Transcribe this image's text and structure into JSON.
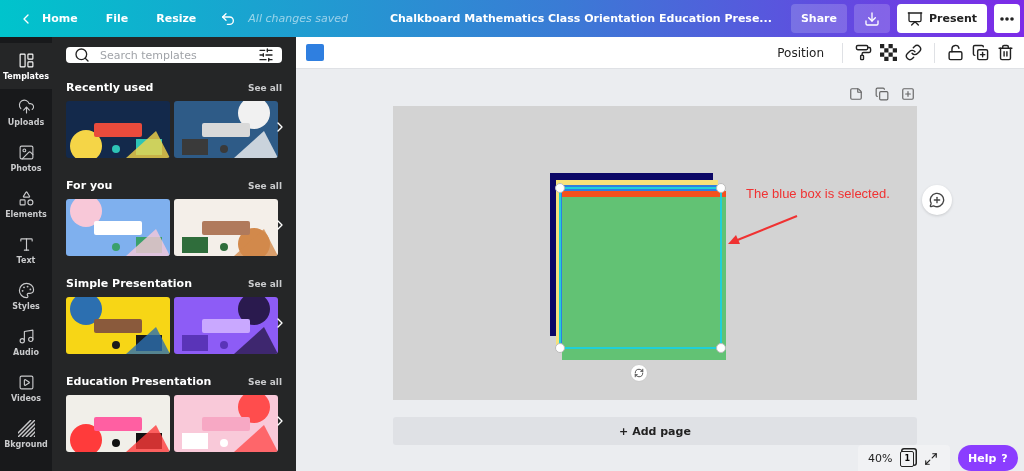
{
  "top_bar": {
    "back_label": "Home",
    "menu": [
      "File",
      "Resize"
    ],
    "status": "All changes saved",
    "title": "Chalkboard Mathematics Class Orientation Education Prese...",
    "share": "Share",
    "present": "Present"
  },
  "rail": [
    {
      "kind": "templates",
      "label": "Templates",
      "selected": true
    },
    {
      "kind": "uploads",
      "label": "Uploads",
      "selected": false
    },
    {
      "kind": "photos",
      "label": "Photos",
      "selected": false
    },
    {
      "kind": "elements",
      "label": "Elements",
      "selected": false
    },
    {
      "kind": "text",
      "label": "Text",
      "selected": false
    },
    {
      "kind": "styles",
      "label": "Styles",
      "selected": false
    },
    {
      "kind": "audio",
      "label": "Audio",
      "selected": false
    },
    {
      "kind": "videos",
      "label": "Videos",
      "selected": false
    },
    {
      "kind": "background",
      "label": "Bkground",
      "selected": false
    }
  ],
  "search": {
    "placeholder": "Search templates"
  },
  "sections": [
    {
      "title": "Recently used",
      "see_all": "See all"
    },
    {
      "title": "For you",
      "see_all": "See all"
    },
    {
      "title": "Simple Presentation",
      "see_all": "See all"
    },
    {
      "title": "Education Presentation",
      "see_all": "See all"
    }
  ],
  "toolbar": {
    "position": "Position"
  },
  "canvas": {
    "shapes": [
      {
        "color": "#0c0766"
      },
      {
        "color": "#f7e27a"
      },
      {
        "color": "#2f7fe0"
      },
      {
        "color": "#f4511e"
      },
      {
        "color": "#62c274"
      }
    ],
    "annotation": "The blue box is selected.",
    "add_page": "+ Add page"
  },
  "footer": {
    "zoom": "40%",
    "page_count": "1",
    "help": "Help",
    "help_mark": "?"
  }
}
